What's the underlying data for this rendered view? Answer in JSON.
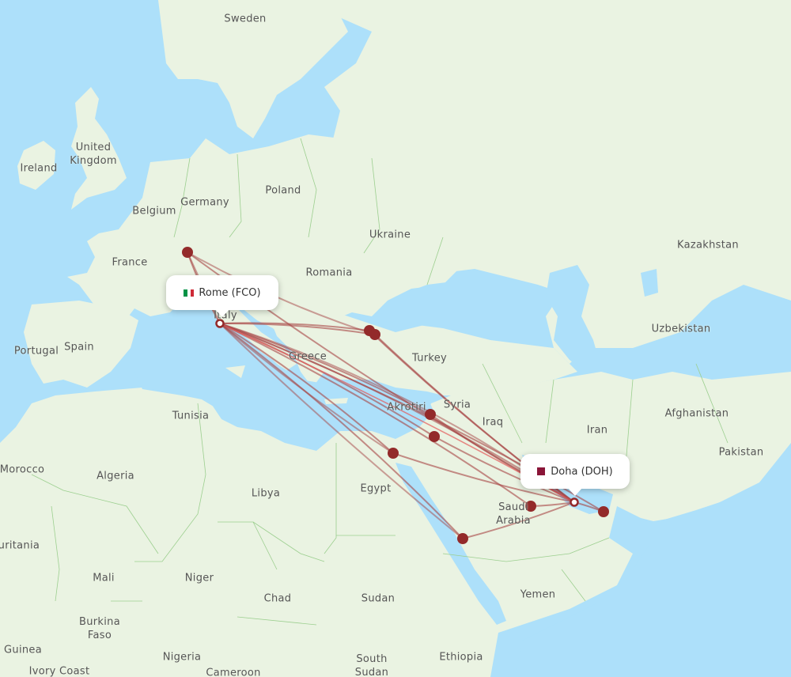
{
  "map": {
    "colors": {
      "water": "#ade0fa",
      "land": "#eaf3e2",
      "border": "#9ccf8f",
      "route": "#a64545",
      "route_highlight": "#e45a5a",
      "marker": "#932a2a"
    },
    "country_labels": [
      {
        "name": "Sweden"
      },
      {
        "name": "United Kingdom"
      },
      {
        "name": "Ireland"
      },
      {
        "name": "Germany"
      },
      {
        "name": "Belgium"
      },
      {
        "name": "Poland"
      },
      {
        "name": "Ukraine"
      },
      {
        "name": "France"
      },
      {
        "name": "Romania"
      },
      {
        "name": "Kazakhstan"
      },
      {
        "name": "Italy"
      },
      {
        "name": "Portugal"
      },
      {
        "name": "Spain"
      },
      {
        "name": "Greece"
      },
      {
        "name": "Turkey"
      },
      {
        "name": "Uzbekistan"
      },
      {
        "name": "Tunisia"
      },
      {
        "name": "Akrotiri"
      },
      {
        "name": "Syria"
      },
      {
        "name": "Iraq"
      },
      {
        "name": "Iran"
      },
      {
        "name": "Afghanistan"
      },
      {
        "name": "Pakistan"
      },
      {
        "name": "Morocco"
      },
      {
        "name": "Algeria"
      },
      {
        "name": "Libya"
      },
      {
        "name": "Egypt"
      },
      {
        "name": "Saudi Arabia"
      },
      {
        "name": "Mauritania"
      },
      {
        "name": "Mali"
      },
      {
        "name": "Niger"
      },
      {
        "name": "Chad"
      },
      {
        "name": "Sudan"
      },
      {
        "name": "Yemen"
      },
      {
        "name": "Burkina Faso"
      },
      {
        "name": "Guinea"
      },
      {
        "name": "Nigeria"
      },
      {
        "name": "Ethiopia"
      },
      {
        "name": "South Sudan"
      },
      {
        "name": "Ivory Coast"
      },
      {
        "name": "Cameroon"
      }
    ],
    "origin": {
      "city": "Rome",
      "code": "FCO",
      "label": "Rome (FCO)",
      "flag_colors": [
        "#009246",
        "#ffffff",
        "#ce2b37"
      ]
    },
    "destination": {
      "city": "Doha",
      "code": "DOH",
      "label": "Doha (DOH)",
      "flag_color": "#8a1538"
    },
    "stopovers": [
      {
        "id": "zurich"
      },
      {
        "id": "istanbul-1"
      },
      {
        "id": "istanbul-2"
      },
      {
        "id": "beirut"
      },
      {
        "id": "amman"
      },
      {
        "id": "cairo"
      },
      {
        "id": "riyadh"
      },
      {
        "id": "jeddah"
      },
      {
        "id": "abu-dhabi"
      }
    ]
  }
}
